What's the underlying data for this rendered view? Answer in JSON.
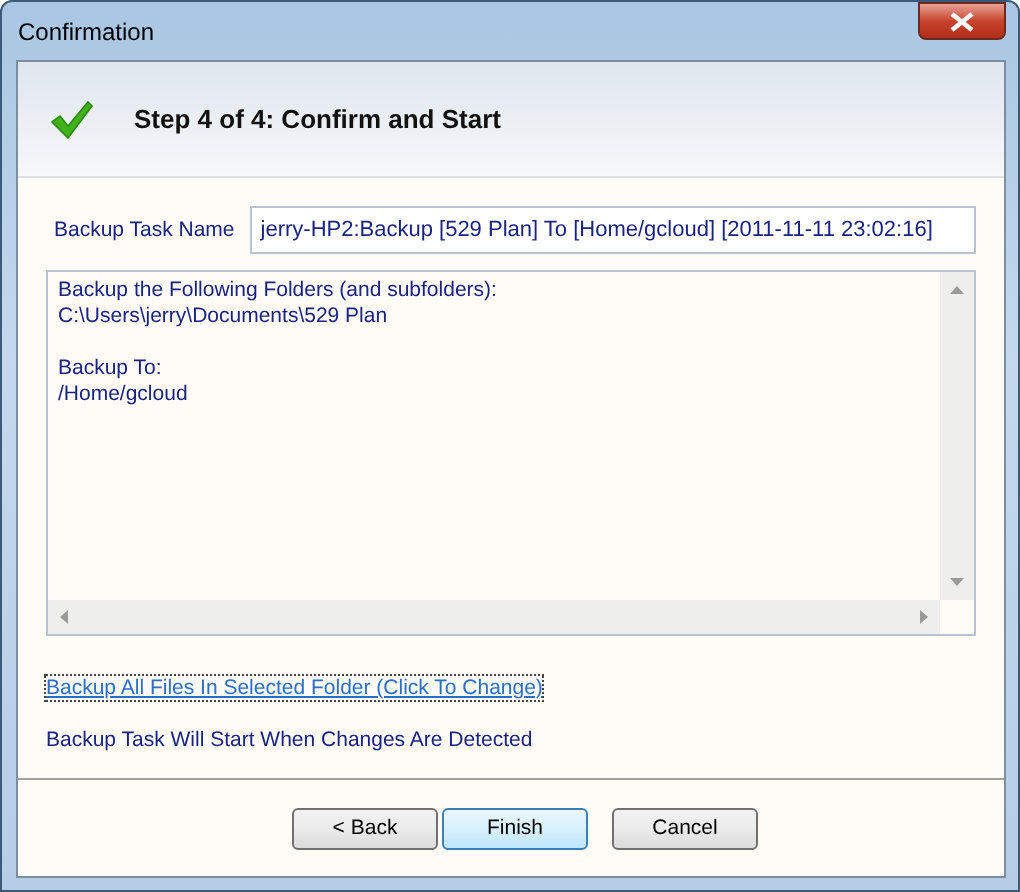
{
  "window": {
    "title": "Confirmation"
  },
  "header": {
    "title": "Step 4 of 4:  Confirm and Start"
  },
  "task_name": {
    "label": "Backup Task Name",
    "value": "jerry-HP2:Backup [529 Plan] To [Home/gcloud] [2011-11-11 23:02:16]"
  },
  "summary": {
    "sections": [
      {
        "heading": "Backup the Following Folders (and subfolders):",
        "path": "C:\\Users\\jerry\\Documents\\529 Plan"
      },
      {
        "heading": "Backup To:",
        "path": "/Home/gcloud"
      }
    ]
  },
  "filter_link": "Backup All Files In Selected Folder (Click To Change)",
  "schedule_note": "Backup Task Will Start When Changes Are Detected",
  "buttons": [
    {
      "label": "< Back",
      "default": false
    },
    {
      "label": "Finish",
      "default": true
    },
    {
      "label": "Cancel",
      "default": false
    }
  ]
}
